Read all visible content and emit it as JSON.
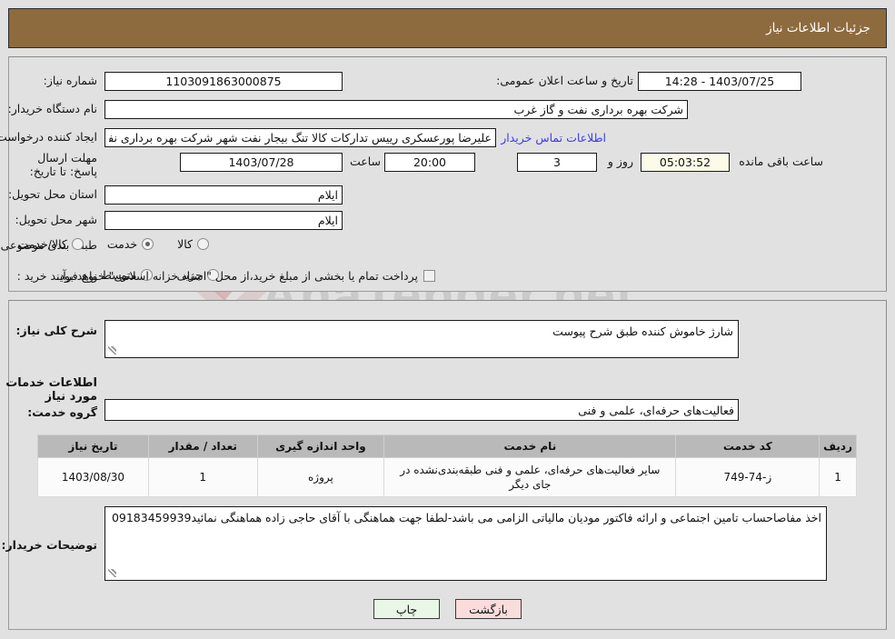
{
  "header": {
    "title": "جزئیات اطلاعات نیاز"
  },
  "top_panel": {
    "need_number_label": "شماره نیاز:",
    "need_number_value": "1103091863000875",
    "announce_label": "تاریخ و ساعت اعلان عمومی:",
    "announce_value": "14:28 - 1403/07/25",
    "buyer_org_label": "نام دستگاه خریدار:",
    "buyer_org_value": "شرکت بهره برداری نفت و گاز غرب",
    "creator_label": "ایجاد کننده درخواست:",
    "creator_value": "علیرضا پورعسکری رییس تدارکات کالا تنگ بیجار نفت شهر شرکت بهره برداری نفت و گاز غرب",
    "contact_link": "اطلاعات تماس خریدار",
    "deadline_label": "مهلت ارسال پاسخ: تا تاریخ:",
    "deadline_date": "1403/07/28",
    "hour_label": "ساعت",
    "hour_value": "20:00",
    "days_value": "3",
    "days_label": "روز و",
    "timer_value": "05:03:52",
    "timer_label": "ساعت باقی مانده",
    "province_label": "استان محل تحویل:",
    "province_value": "ایلام",
    "city_label": "شهر محل تحویل:",
    "city_value": "ایلام",
    "category_label": "طبقه بندی موضوعی:",
    "category_options": [
      {
        "label": "کالا",
        "checked": false
      },
      {
        "label": "خدمت",
        "checked": true
      },
      {
        "label": "کالا/خدمت",
        "checked": false
      }
    ],
    "process_label": "نوع فرآیند خرید :",
    "process_options": [
      {
        "label": "جزیی",
        "checked": false
      },
      {
        "label": "متوسط",
        "checked": false
      }
    ],
    "treasury_checkbox_label": "پرداخت تمام یا بخشی از مبلغ خرید،از محل \"اسناد خزانه اسلامی\" خواهد بود.",
    "treasury_checked": false
  },
  "bottom_panel": {
    "general_desc_label": "شرح کلی نیاز:",
    "general_desc_value": "شارژ خاموش کننده طبق شرح پیوست",
    "services_section_title": "اطلاعات خدمات مورد نیاز",
    "service_group_label": "گروه خدمت:",
    "service_group_value": "فعالیت‌های حرفه‌ای، علمی و فنی",
    "table": {
      "headers": [
        "ردیف",
        "کد خدمت",
        "نام خدمت",
        "واحد اندازه گیری",
        "تعداد / مقدار",
        "تاریخ نیاز"
      ],
      "rows": [
        {
          "index": "1",
          "code": "ز-74-749",
          "name": "سایر فعالیت‌های حرفه‌ای، علمی و فنی طبقه‌بندی‌نشده در جای دیگر",
          "unit": "پروژه",
          "quantity": "1",
          "need_date": "1403/08/30"
        }
      ]
    },
    "buyer_notes_label": "توضیحات خریدار:",
    "buyer_notes_value": "اخذ مفاصاحساب تامین اجتماعی و ارائه فاکتور مودیان مالیاتی الزامی می باشد-لطفا جهت هماهنگی با آقای حاجی زاده هماهنگی نمائید09183459939"
  },
  "buttons": {
    "print": "چاپ",
    "back": "بازگشت"
  },
  "watermark": {
    "text": "AnaTender.net"
  },
  "colors": {
    "header_bg": "#8d6b3f",
    "page_bg": "#e1e1e1",
    "link": "#3a3af0",
    "table_header_bg": "#b9b9b9",
    "timer_bg": "#fbfbe8",
    "print_btn_bg": "#e9f7e6",
    "back_btn_bg": "#fbdcdc"
  }
}
